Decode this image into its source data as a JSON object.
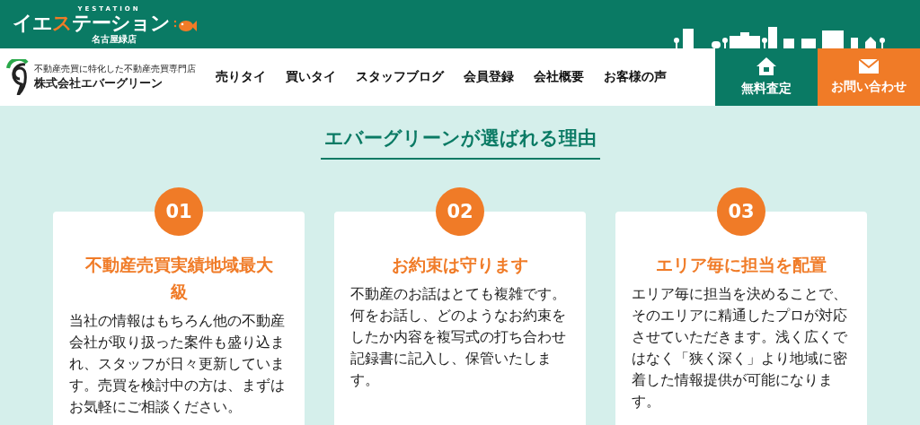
{
  "brand": {
    "tagline": "YESTATION",
    "name_head": "イエ",
    "name_accent": "ス",
    "name_tail": "テーション",
    "branch": "名古屋緑店"
  },
  "company": {
    "subtitle": "不動産売買に特化した不動産売買専門店",
    "name": "株式会社エバーグリーン"
  },
  "nav": [
    "売りタイ",
    "買いタイ",
    "スタッフブログ",
    "会員登録",
    "会社概要",
    "お客様の声"
  ],
  "actions": [
    {
      "kind": "assess",
      "label": "無料査定"
    },
    {
      "kind": "contact",
      "label": "お問い合わせ"
    }
  ],
  "section": {
    "title": "エバーグリーンが選ばれる理由",
    "cards": [
      {
        "number": "01",
        "title": "不動産売買実績地域最大級",
        "text": "当社の情報はもちろん他の不動産会社が取り扱った案件も盛り込まれ、スタッフが日々更新しています。売買を検討中の方は、まずはお気軽にご相談ください。"
      },
      {
        "number": "02",
        "title": "お約束は守ります",
        "text": "不動産のお話はとても複雑です。何をお話し、どのようなお約束をしたか内容を複写式の打ち合わせ記録書に記入し、保管いたします。"
      },
      {
        "number": "03",
        "title": "エリア毎に担当を配置",
        "text": "エリア毎に担当を決めることで、そのエリアに精通したプロが対応させていただきます。浅く広くではなく「狭く深く」より地域に密着した情報提供が可能になります。"
      }
    ]
  }
}
